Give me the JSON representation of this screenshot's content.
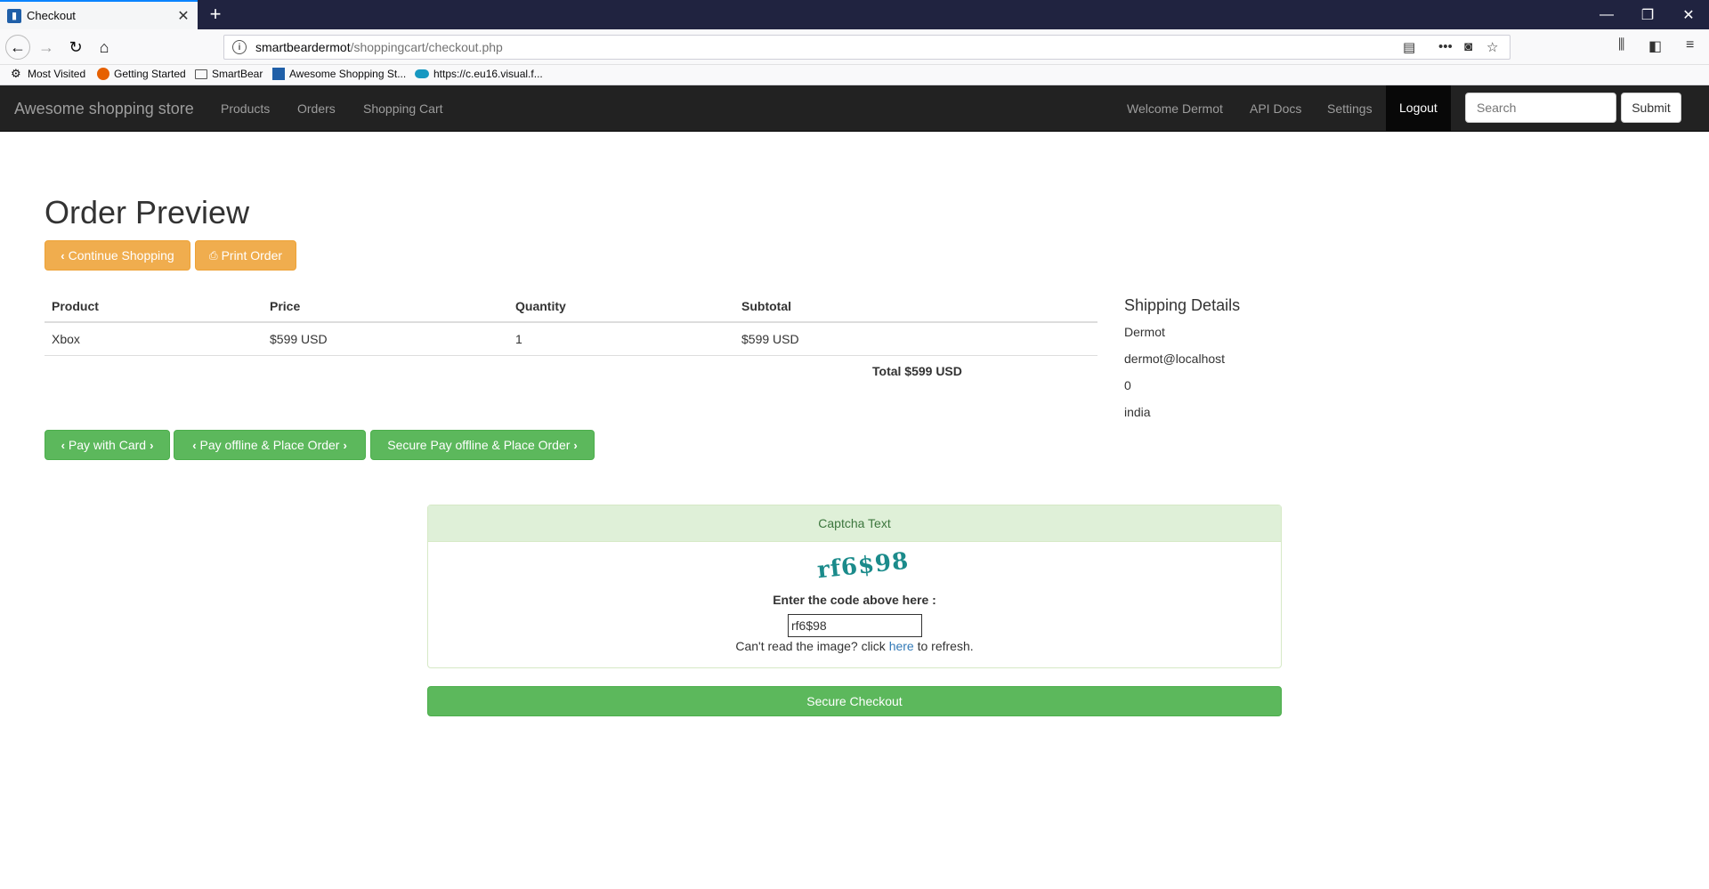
{
  "browser": {
    "tab_title": "Checkout",
    "url_host": "smartbeardermot",
    "url_path": "/shoppingcart/checkout.php",
    "bookmarks": [
      "Most Visited",
      "Getting Started",
      "SmartBear",
      "Awesome Shopping St...",
      "https://c.eu16.visual.f..."
    ]
  },
  "site": {
    "brand": "Awesome shopping store",
    "nav_left": [
      "Products",
      "Orders",
      "Shopping Cart"
    ],
    "nav_right": [
      "Welcome Dermot",
      "API Docs",
      "Settings",
      "Logout"
    ],
    "search_placeholder": "Search",
    "submit_label": "Submit"
  },
  "page": {
    "title": "Order Preview",
    "continue_label": "Continue Shopping",
    "print_label": "Print Order"
  },
  "cart": {
    "headers": [
      "Product",
      "Price",
      "Quantity",
      "Subtotal"
    ],
    "rows": [
      [
        "Xbox",
        "$599 USD",
        "1",
        "$599 USD"
      ]
    ],
    "total": "Total $599 USD"
  },
  "shipping": {
    "title": "Shipping Details",
    "lines": [
      "Dermot",
      "dermot@localhost",
      "0",
      "india"
    ]
  },
  "payment": {
    "pay_card": "Pay with Card",
    "pay_offline": "Pay offline & Place Order",
    "secure_pay_offline": "Secure Pay offline & Place Order"
  },
  "captcha": {
    "heading": "Captcha Text",
    "image_text": "rf6$98",
    "label": "Enter the code above here :",
    "input_value": "rf6$98",
    "refresh_prefix": "Can't read the image? click ",
    "refresh_link": "here",
    "refresh_suffix": " to refresh."
  },
  "checkout": {
    "label": "Secure Checkout"
  },
  "colors": {
    "navbar": "#222222",
    "warning": "#f0ad4e",
    "success": "#5cb85c",
    "panel_heading": "#dff0d8"
  }
}
